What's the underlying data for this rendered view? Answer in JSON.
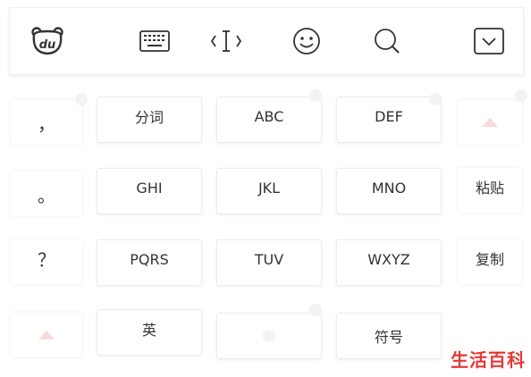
{
  "toolbar": {
    "items": [
      {
        "name": "du-logo-icon"
      },
      {
        "name": "keyboard-icon"
      },
      {
        "name": "cursor-move-icon"
      },
      {
        "name": "emoji-icon"
      },
      {
        "name": "search-icon"
      },
      {
        "name": "collapse-keyboard-icon"
      }
    ],
    "logo_text": "du"
  },
  "keys": {
    "comma": "，",
    "segment": "分词",
    "abc": "ABC",
    "def": "DEF",
    "period": "。",
    "ghi": "GHI",
    "jkl": "JKL",
    "mno": "MNO",
    "paste": "粘贴",
    "question": "？",
    "pqrs": "PQRS",
    "tuv": "TUV",
    "wxyz": "WXYZ",
    "copy": "复制",
    "english": "英",
    "symbols": "符号"
  },
  "watermark": "生活百科",
  "colors": {
    "background": "#ffffff",
    "key_text": "#333333",
    "watermark": "#e53935",
    "accent_pink": "#f7dada"
  }
}
